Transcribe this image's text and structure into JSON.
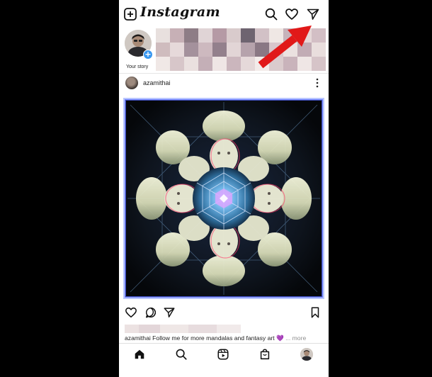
{
  "app": {
    "title": "Instagram"
  },
  "topbar": {
    "new_post_icon": "plus-square-icon",
    "search_icon": "search-icon",
    "activity_icon": "heart-icon",
    "direct_icon": "paper-plane-icon"
  },
  "stories": {
    "own_label": "Your story",
    "badge": "+"
  },
  "post": {
    "username": "azamithai",
    "options_icon": "more-vertical-icon",
    "caption_user": "azamithai",
    "caption_text": "Follow me for more mandalas and fantasy art",
    "caption_heart": "💜",
    "caption_more": "... more",
    "actions": {
      "like_icon": "heart-icon",
      "comment_icon": "comment-icon",
      "share_icon": "paper-plane-icon",
      "save_icon": "bookmark-icon"
    }
  },
  "bottom_nav": {
    "items": [
      "home-icon",
      "search-icon",
      "reels-icon",
      "shop-icon",
      "profile-avatar"
    ]
  },
  "colors": {
    "accent_blue": "#3897f0",
    "annotation_red": "#e11919",
    "caption_heart": "#8a4bd6"
  }
}
